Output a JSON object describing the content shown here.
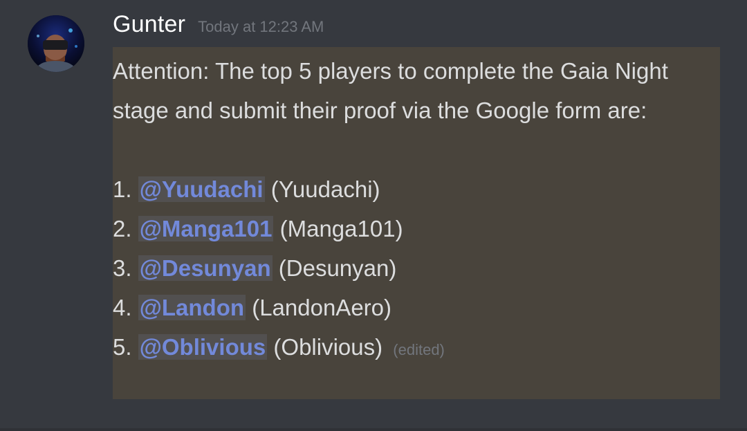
{
  "message": {
    "author": "Gunter",
    "timestamp": "Today at 12:23 AM",
    "intro": "Attention: The top 5 players to complete the Gaia Night stage and submit their proof via the Google form are:",
    "list": [
      {
        "number": "1.",
        "mention": "@Yuudachi",
        "name": "(Yuudachi)"
      },
      {
        "number": "2.",
        "mention": "@Manga101",
        "name": "(Manga101)"
      },
      {
        "number": "3.",
        "mention": "@Desunyan",
        "name": "(Desunyan)"
      },
      {
        "number": "4.",
        "mention": "@Landon",
        "name": "(LandonAero)"
      },
      {
        "number": "5.",
        "mention": "@Oblivious",
        "name": "(Oblivious)"
      }
    ],
    "edited_label": "(edited)"
  },
  "colors": {
    "background": "#36393f",
    "highlight": "#49443c",
    "mention": "#7289da",
    "muted": "#72767d",
    "text": "#dcddde"
  }
}
